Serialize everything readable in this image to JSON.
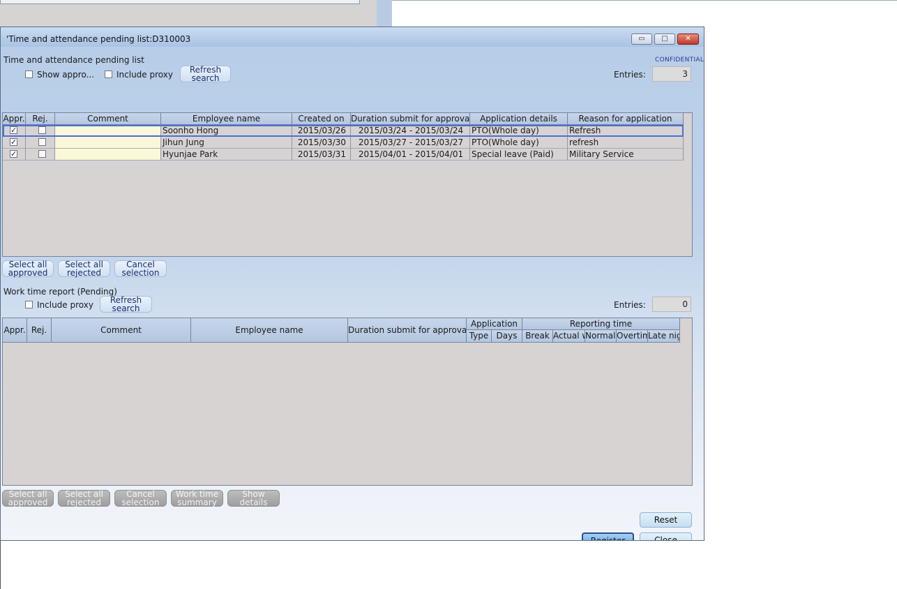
{
  "window": {
    "title": "Time and attendance pending list:D310003",
    "title_prefix": "'",
    "controls": {
      "minimize": "▭",
      "maximize": "□",
      "close": "✕"
    }
  },
  "pending": {
    "section_label": "Time and attendance pending list",
    "confidential": "CONFIDENTIAL",
    "show_approved_label": "Show appro...",
    "include_proxy_label": "Include proxy",
    "refresh_line1": "Refresh",
    "refresh_line2": "search",
    "entries_label": "Entries:",
    "entries_value": "3",
    "columns": [
      "Appr.",
      "Rej.",
      "Comment",
      "Employee name",
      "Created on",
      "Duration submit for approval",
      "Application details",
      "Reason for application"
    ],
    "rows": [
      {
        "appr": true,
        "rej": false,
        "comment": "",
        "employee": "Soonho Hong",
        "created": "2015/03/26",
        "duration": "2015/03/24 - 2015/03/24",
        "details": "PTO(Whole day)",
        "reason": "Refresh"
      },
      {
        "appr": true,
        "rej": false,
        "comment": "",
        "employee": "Jihun Jung",
        "created": "2015/03/30",
        "duration": "2015/03/27 - 2015/03/27",
        "details": "PTO(Whole day)",
        "reason": "refresh"
      },
      {
        "appr": true,
        "rej": false,
        "comment": "",
        "employee": "Hyunjae Park",
        "created": "2015/03/31",
        "duration": "2015/04/01 - 2015/04/01",
        "details": "Special leave (Paid)",
        "reason": "Military Service"
      }
    ],
    "buttons": [
      {
        "line1": "Select all",
        "line2": "approved"
      },
      {
        "line1": "Select all",
        "line2": "rejected"
      },
      {
        "line1": "Cancel",
        "line2": "selection"
      }
    ]
  },
  "worktime": {
    "section_label": "Work time report (Pending)",
    "include_proxy_label": "Include proxy",
    "refresh_line1": "Refresh",
    "refresh_line2": "search",
    "entries_label": "Entries:",
    "entries_value": "0",
    "col_appr": "Appr.",
    "col_rej": "Rej.",
    "col_comment": "Comment",
    "col_employee": "Employee name",
    "col_duration": "Duration submit for approval",
    "group_application": "Application",
    "col_type": "Type",
    "col_days": "Days",
    "group_reporting": "Reporting time",
    "col_break": "Break",
    "col_actual": "Actual w",
    "col_normal": "Normal",
    "col_overtime": "Overtim",
    "col_latenight": "Late nig",
    "buttons": [
      {
        "line1": "Select all",
        "line2": "approved"
      },
      {
        "line1": "Select all",
        "line2": "rejected"
      },
      {
        "line1": "Cancel",
        "line2": "selection"
      },
      {
        "line1": "Work time",
        "line2": "summary"
      },
      {
        "line1": "Show details",
        "line2": ""
      }
    ]
  },
  "footer": {
    "reset": "Reset",
    "register": "Register",
    "close": "Close"
  }
}
